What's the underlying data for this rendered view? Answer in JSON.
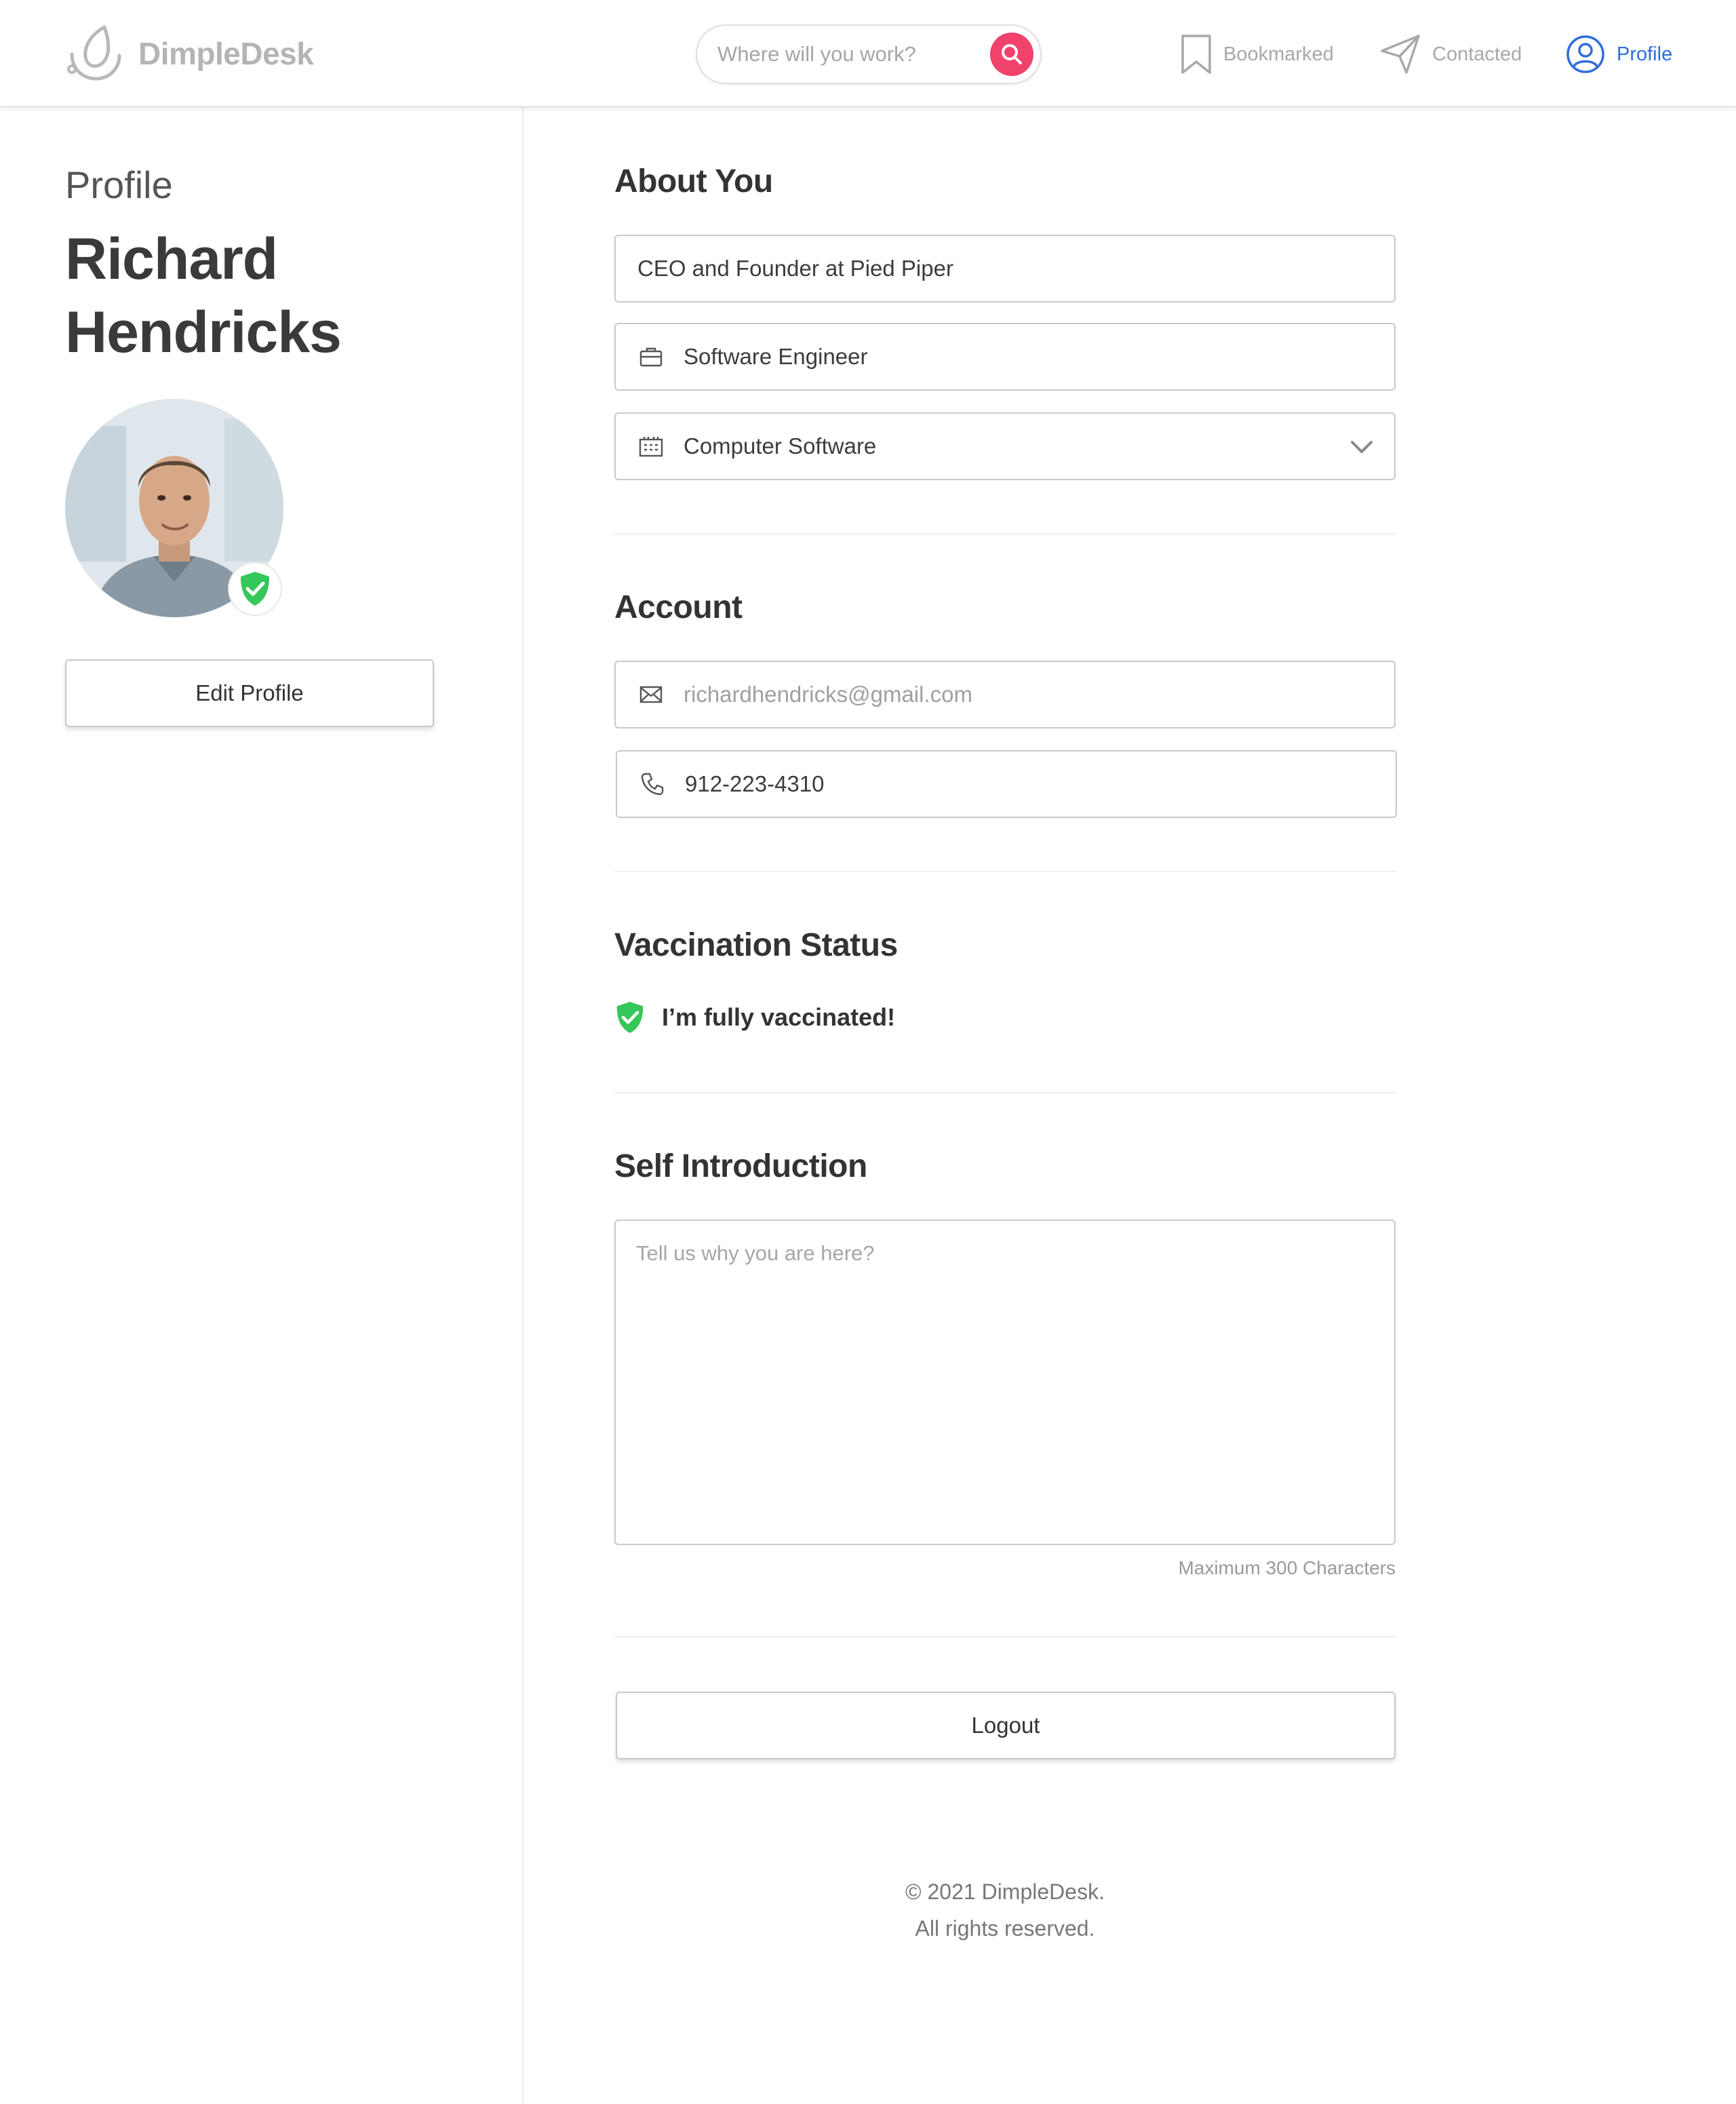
{
  "brand": {
    "name": "DimpleDesk"
  },
  "search": {
    "placeholder": "Where will you work?"
  },
  "nav": {
    "bookmarked": "Bookmarked",
    "contacted": "Contacted",
    "profile": "Profile",
    "active": "profile"
  },
  "sidebar": {
    "kicker": "Profile",
    "name": "Richard Hendricks",
    "edit_label": "Edit Profile"
  },
  "about": {
    "title": "About You",
    "headline": "CEO and Founder at Pied Piper",
    "job_title": "Software Engineer",
    "industry": "Computer Software"
  },
  "account": {
    "title": "Account",
    "email": "richardhendricks@gmail.com",
    "phone": "912-223-4310"
  },
  "vaccination": {
    "title": "Vaccination Status",
    "status": "I’m fully vaccinated!"
  },
  "intro": {
    "title": "Self Introduction",
    "placeholder": "Tell us why you are here?",
    "hint": "Maximum 300 Characters"
  },
  "logout_label": "Logout",
  "footer": {
    "line1": "© 2021 DimpleDesk.",
    "line2": "All rights reserved."
  },
  "colors": {
    "accent_blue": "#2f6ddb",
    "search_pink": "#f0426b",
    "verified_green": "#34c759",
    "icons": [
      "logo-icon",
      "search-icon",
      "bookmark-icon",
      "send-icon",
      "user-icon",
      "shield-check-icon",
      "briefcase-icon",
      "building-icon",
      "chevron-down-icon",
      "mail-icon",
      "phone-icon"
    ]
  }
}
